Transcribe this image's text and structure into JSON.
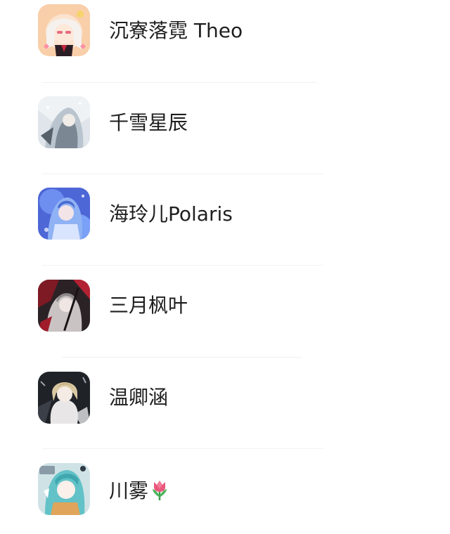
{
  "contacts": [
    {
      "name": "沉寮落霓 Theo",
      "avatar_icon": "anime-girl-white-hair-avatar-icon",
      "bg": "#f6c8a8"
    },
    {
      "name": "千雪星辰",
      "avatar_icon": "anime-white-snow-avatar-icon",
      "bg": "#cfd8e0"
    },
    {
      "name": "海玲儿Polaris",
      "avatar_icon": "anime-blue-hair-avatar-icon",
      "bg": "#5b7ae0"
    },
    {
      "name": "三月枫叶",
      "avatar_icon": "anime-dark-red-avatar-icon",
      "bg": "#3a2b2f"
    },
    {
      "name": "温卿涵",
      "avatar_icon": "anime-blonde-boy-avatar-icon",
      "bg": "#2a2d33"
    },
    {
      "name": "川雾",
      "emoji_icon": "tulip-icon",
      "avatar_icon": "anime-teal-hair-avatar-icon",
      "bg": "#9fd3d6"
    }
  ]
}
